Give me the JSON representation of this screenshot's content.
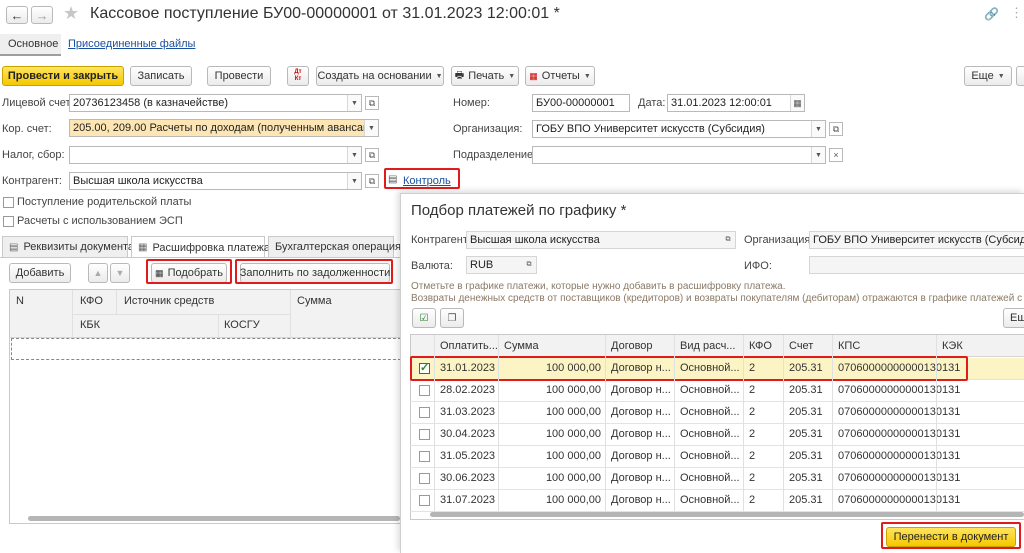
{
  "window": {
    "title": "Кассовое поступление БУ00-00000001 от 31.01.2023 12:00:01 *",
    "back_icon": "arrow-left-icon",
    "forward_icon": "arrow-right-icon",
    "star_icon": "star-icon",
    "link_icon": "link-icon",
    "more_icon": "more-vertical-icon"
  },
  "nav": {
    "main_tab": "Основное",
    "attached_files": "Присоединенные файлы"
  },
  "toolbar": {
    "post_close": "Провести и закрыть",
    "save": "Записать",
    "post": "Провести",
    "dt_kt_icon": "Дт Кт",
    "create_based": "Создать на основании",
    "print": "Печать",
    "reports": "Отчеты",
    "more": "Еще"
  },
  "form": {
    "account_label": "Лицевой счет:",
    "account_value": "20736123458 (в казначействе)",
    "kor_label": "Кор. счет:",
    "kor_value": "205.00, 209.00 Расчеты по доходам (полученным авансам)",
    "tax_label": "Налог, сбор:",
    "tax_value": "",
    "contractor_label": "Контрагент:",
    "contractor_value": "Высшая школа искусства",
    "control_link": "Контроль",
    "number_label": "Номер:",
    "number_value": "БУ00-00000001",
    "date_label": "Дата:",
    "date_value": "31.01.2023 12:00:01",
    "org_label": "Организация:",
    "org_value": "ГОБУ ВПО Университет искусств (Субсидия)",
    "dept_label": "Подразделение:",
    "dept_value": "",
    "parent_pay_label": "Поступление родительской платы",
    "esp_label": "Расчеты с использованием ЭСП"
  },
  "tabs": {
    "requisites": "Реквизиты документа",
    "payment": "Расшифровка платежа",
    "accounting": "Бухгалтерская операция"
  },
  "payment_toolbar": {
    "add": "Добавить",
    "select": "Подобрать",
    "fill_debt": "Заполнить по задолженности"
  },
  "payment_grid": {
    "headers": [
      "N",
      "КФО",
      "Источник средств",
      "Сумма"
    ],
    "subheaders": [
      "КБК",
      "КОСГУ"
    ]
  },
  "dialog": {
    "title": "Подбор платежей по графику *",
    "contractor_label": "Контрагент:",
    "contractor_value": "Высшая школа искусства",
    "org_label": "Организация:",
    "org_value": "ГОБУ ВПО Университет искусств (Субсидия)",
    "currency_label": "Валюта:",
    "currency_value": "RUB",
    "ifo_label": "ИФО:",
    "ifo_value": "",
    "hint1": "Отметьте в графике платежи, которые нужно добавить в расшифровку платежа.",
    "hint2": "Возвраты денежных средств от поставщиков (кредиторов) и возвраты покупателям (дебиторам) отражаются в графике платежей с ми",
    "more_btn": "Ещ",
    "transfer_button": "Перенести в документ",
    "headers": [
      "Оплатить...",
      "Сумма",
      "Договор",
      "Вид расч...",
      "КФО",
      "Счет",
      "КПС",
      "КЭК"
    ],
    "rows": [
      {
        "checked": true,
        "date": "31.01.2023",
        "sum": "100 000,00",
        "contract": "Договор н...",
        "type": "Основной...",
        "kfo": "2",
        "account": "205.31",
        "kps": "07060000000000130",
        "kek": "131"
      },
      {
        "checked": false,
        "date": "28.02.2023",
        "sum": "100 000,00",
        "contract": "Договор н...",
        "type": "Основной...",
        "kfo": "2",
        "account": "205.31",
        "kps": "07060000000000130",
        "kek": "131"
      },
      {
        "checked": false,
        "date": "31.03.2023",
        "sum": "100 000,00",
        "contract": "Договор н...",
        "type": "Основной...",
        "kfo": "2",
        "account": "205.31",
        "kps": "07060000000000130",
        "kek": "131"
      },
      {
        "checked": false,
        "date": "30.04.2023",
        "sum": "100 000,00",
        "contract": "Договор н...",
        "type": "Основной...",
        "kfo": "2",
        "account": "205.31",
        "kps": "07060000000000130",
        "kek": "131"
      },
      {
        "checked": false,
        "date": "31.05.2023",
        "sum": "100 000,00",
        "contract": "Договор н...",
        "type": "Основной...",
        "kfo": "2",
        "account": "205.31",
        "kps": "07060000000000130",
        "kek": "131"
      },
      {
        "checked": false,
        "date": "30.06.2023",
        "sum": "100 000,00",
        "contract": "Договор н...",
        "type": "Основной...",
        "kfo": "2",
        "account": "205.31",
        "kps": "07060000000000130",
        "kek": "131"
      },
      {
        "checked": false,
        "date": "31.07.2023",
        "sum": "100 000,00",
        "contract": "Договор н...",
        "type": "Основной...",
        "kfo": "2",
        "account": "205.31",
        "kps": "07060000000000130",
        "kek": "131"
      }
    ]
  },
  "colors": {
    "accent_yellow": "#f5c800",
    "highlight_red": "#e01b1b",
    "selected_row": "#fdf4c5",
    "field_highlight": "#fde6b3",
    "link_blue": "#1a4fa0"
  }
}
